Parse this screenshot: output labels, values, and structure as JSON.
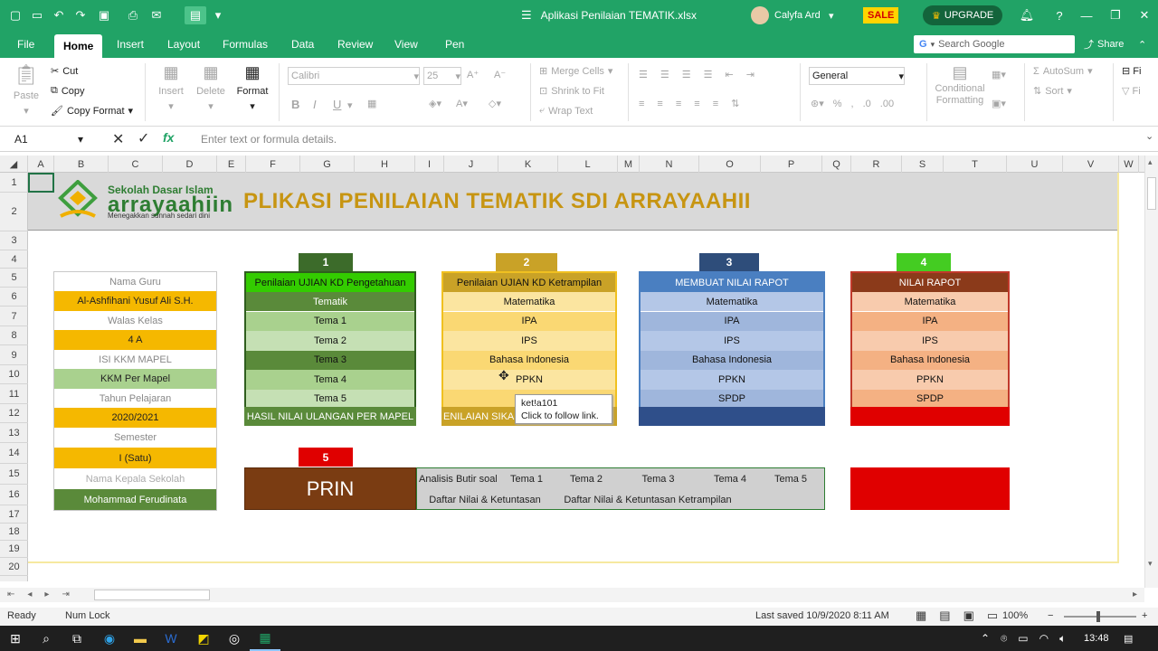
{
  "window": {
    "title": "Aplikasi Penilaian TEMATIK.xlsx",
    "user": "Calyfa Ard",
    "sale_label": "SALE",
    "upgrade_label": "UPGRADE"
  },
  "tabs": [
    "File",
    "Home",
    "Insert",
    "Layout",
    "Formulas",
    "Data",
    "Review",
    "View",
    "Pen"
  ],
  "search": {
    "placeholder": "Search Google"
  },
  "share_label": "Share",
  "clipboard": {
    "paste": "Paste",
    "cut": "Cut",
    "copy": "Copy",
    "copy_format": "Copy Format"
  },
  "cells_group": {
    "insert": "Insert",
    "delete": "Delete",
    "format": "Format"
  },
  "font": {
    "name": "Calibri",
    "size": "25"
  },
  "align": {
    "merge": "Merge Cells",
    "shrink": "Shrink to Fit",
    "wrap": "Wrap Text"
  },
  "number": {
    "format": "General"
  },
  "styles": {
    "conditional": "Conditional",
    "formatting": "Formatting"
  },
  "editing": {
    "autosum": "AutoSum",
    "sort": "Sort"
  },
  "formula": {
    "name_box": "A1",
    "fx": "fx",
    "placeholder": "Enter text or formula details."
  },
  "columns": [
    "A",
    "B",
    "C",
    "D",
    "E",
    "F",
    "G",
    "H",
    "I",
    "J",
    "K",
    "L",
    "M",
    "N",
    "O",
    "P",
    "Q",
    "R",
    "S",
    "T",
    "U",
    "V",
    "W"
  ],
  "rows": [
    "1",
    "2",
    "3",
    "4",
    "5",
    "6",
    "7",
    "8",
    "9",
    "10",
    "11",
    "12",
    "13",
    "14",
    "15",
    "16",
    "17",
    "18",
    "19",
    "20"
  ],
  "header": {
    "logo_line1": "Sekolah Dasar Islam",
    "logo_line2": "arrayaahiin",
    "logo_line3": "Menegakkan sunnah sedari dini",
    "title": "PLIKASI PENILAIAN TEMATIK SDI ARRAYAAHII"
  },
  "info": {
    "rows": [
      "Nama Guru",
      "Al-Ashfihani Yusuf Ali S.H.",
      "Walas Kelas",
      "4 A",
      "ISI KKM MAPEL",
      "KKM Per Mapel",
      "Tahun Pelajaran",
      "2020/2021",
      "Semester",
      "I (Satu)",
      "Nama Kepala Sekolah",
      "Mohammad Ferudinata"
    ]
  },
  "block1": {
    "num": "1",
    "title": "Penilaian UJIAN KD Pengetahuan",
    "items": [
      "Tematik",
      "Tema 1",
      "Tema 2",
      "Tema 3",
      "Tema 4",
      "Tema 5"
    ],
    "footer": "HASIL NILAI ULANGAN PER MAPEL"
  },
  "block2": {
    "num": "2",
    "title": "Penilaian UJIAN KD Ketrampilan",
    "items": [
      "Matematika",
      "IPA",
      "IPS",
      "Bahasa Indonesia",
      "PPKN",
      ""
    ],
    "footer": "ENILAIAN SIKAP"
  },
  "block3": {
    "num": "3",
    "title": "MEMBUAT NILAI RAPOT",
    "items": [
      "Matematika",
      "IPA",
      "IPS",
      "Bahasa Indonesia",
      "PPKN",
      "SPDP"
    ]
  },
  "block4": {
    "num": "4",
    "title": "NILAI RAPOT",
    "items": [
      "Matematika",
      "IPA",
      "IPS",
      "Bahasa Indonesia",
      "PPKN",
      "SPDP"
    ]
  },
  "block5": {
    "num": "5",
    "print": "PRIN",
    "row1": [
      "Analisis Butir soal",
      "Tema 1",
      "Tema 2",
      "Tema 3",
      "Tema 4",
      "Tema 5"
    ],
    "row2": [
      "Daftar Nilai & Ketuntasan",
      "Daftar Nilai & Ketuntasan Ketrampilan"
    ]
  },
  "tooltip": {
    "line1": "ket!a101",
    "line2": "Click to follow link."
  },
  "status": {
    "ready": "Ready",
    "numlock": "Num Lock",
    "saved": "Last saved 10/9/2020 8:11 AM",
    "zoom": "100%"
  },
  "taskbar": {
    "time": "13:48"
  }
}
